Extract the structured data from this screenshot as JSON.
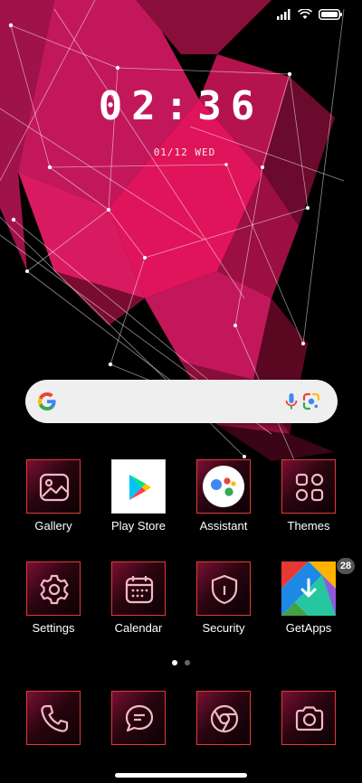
{
  "status_bar": {
    "icons": [
      "signal-icon",
      "wifi-icon",
      "battery-icon"
    ]
  },
  "lockclock": {
    "time": "02:36",
    "date": "01/12 WED"
  },
  "search": {
    "icons": [
      "google-logo-icon",
      "mic-icon",
      "google-lens-icon"
    ]
  },
  "apps": {
    "gallery": {
      "label": "Gallery",
      "icon": "gallery-icon"
    },
    "playstore": {
      "label": "Play Store",
      "icon": "play-store-icon"
    },
    "assistant": {
      "label": "Assistant",
      "icon": "assistant-icon"
    },
    "themes": {
      "label": "Themes",
      "icon": "themes-icon"
    },
    "settings": {
      "label": "Settings",
      "icon": "gear-icon"
    },
    "calendar": {
      "label": "Calendar",
      "icon": "calendar-icon"
    },
    "security": {
      "label": "Security",
      "icon": "shield-icon"
    },
    "getapps": {
      "label": "GetApps",
      "icon": "getapps-icon",
      "badge": "28"
    }
  },
  "dock": {
    "icons": [
      "phone-icon",
      "messages-icon",
      "chrome-icon",
      "camera-icon"
    ]
  },
  "page_indicator": {
    "pages": 2,
    "current": 1
  },
  "colors": {
    "accent": "#e23a33",
    "wallpaper_pink": "#e0145a",
    "badge": "#555555"
  }
}
